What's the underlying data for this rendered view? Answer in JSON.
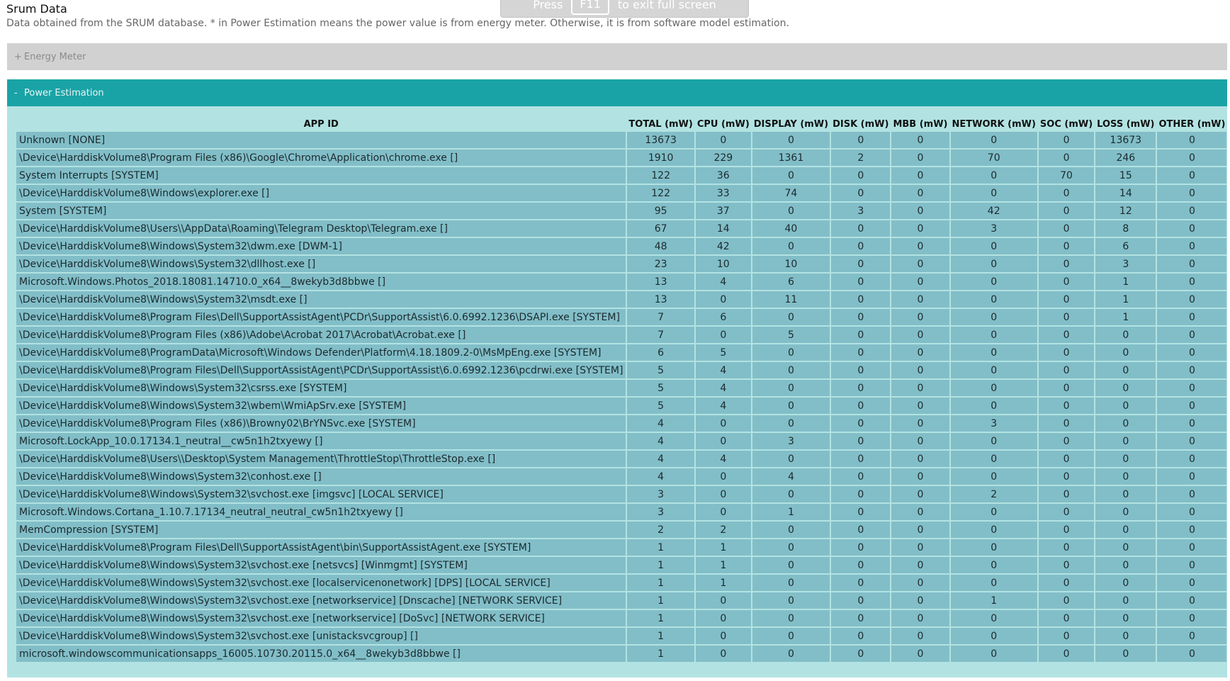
{
  "fullscreen_banner": {
    "press_label": "Press",
    "key_label": "F11",
    "suffix_label": "to exit full screen"
  },
  "page": {
    "title": "Srum Data",
    "subtitle": "Data obtained from the SRUM database. * in Power Estimation means the power value is from energy meter. Otherwise, it is from software model estimation."
  },
  "sections": {
    "energy_meter": {
      "toggle": "+",
      "label": "Energy Meter"
    },
    "power_estimation": {
      "toggle": "-",
      "label": "Power Estimation"
    }
  },
  "colors": {
    "collapsed_header": "#d1d1d1",
    "expanded_header": "#1aa3a6",
    "section_body": "#b2e3e2",
    "cell": "#82bec8"
  },
  "table": {
    "columns": [
      "APP ID",
      "TOTAL (mW)",
      "CPU (mW)",
      "DISPLAY (mW)",
      "DISK (mW)",
      "MBB (mW)",
      "NETWORK (mW)",
      "SOC (mW)",
      "LOSS (mW)",
      "OTHER (mW)"
    ],
    "rows": [
      [
        "Unknown [NONE]",
        "13673",
        "0",
        "0",
        "0",
        "0",
        "0",
        "0",
        "13673",
        "0"
      ],
      [
        "\\Device\\HarddiskVolume8\\Program Files (x86)\\Google\\Chrome\\Application\\chrome.exe []",
        "1910",
        "229",
        "1361",
        "2",
        "0",
        "70",
        "0",
        "246",
        "0"
      ],
      [
        "System Interrupts [SYSTEM]",
        "122",
        "36",
        "0",
        "0",
        "0",
        "0",
        "70",
        "15",
        "0"
      ],
      [
        "\\Device\\HarddiskVolume8\\Windows\\explorer.exe []",
        "122",
        "33",
        "74",
        "0",
        "0",
        "0",
        "0",
        "14",
        "0"
      ],
      [
        "System [SYSTEM]",
        "95",
        "37",
        "0",
        "3",
        "0",
        "42",
        "0",
        "12",
        "0"
      ],
      [
        "\\Device\\HarddiskVolume8\\Users\\\\AppData\\Roaming\\Telegram Desktop\\Telegram.exe []",
        "67",
        "14",
        "40",
        "0",
        "0",
        "3",
        "0",
        "8",
        "0"
      ],
      [
        "\\Device\\HarddiskVolume8\\Windows\\System32\\dwm.exe [DWM-1]",
        "48",
        "42",
        "0",
        "0",
        "0",
        "0",
        "0",
        "6",
        "0"
      ],
      [
        "\\Device\\HarddiskVolume8\\Windows\\System32\\dllhost.exe []",
        "23",
        "10",
        "10",
        "0",
        "0",
        "0",
        "0",
        "3",
        "0"
      ],
      [
        "Microsoft.Windows.Photos_2018.18081.14710.0_x64__8wekyb3d8bbwe []",
        "13",
        "4",
        "6",
        "0",
        "0",
        "0",
        "0",
        "1",
        "0"
      ],
      [
        "\\Device\\HarddiskVolume8\\Windows\\System32\\msdt.exe []",
        "13",
        "0",
        "11",
        "0",
        "0",
        "0",
        "0",
        "1",
        "0"
      ],
      [
        "\\Device\\HarddiskVolume8\\Program Files\\Dell\\SupportAssistAgent\\PCDr\\SupportAssist\\6.0.6992.1236\\DSAPI.exe [SYSTEM]",
        "7",
        "6",
        "0",
        "0",
        "0",
        "0",
        "0",
        "1",
        "0"
      ],
      [
        "\\Device\\HarddiskVolume8\\Program Files (x86)\\Adobe\\Acrobat 2017\\Acrobat\\Acrobat.exe []",
        "7",
        "0",
        "5",
        "0",
        "0",
        "0",
        "0",
        "0",
        "0"
      ],
      [
        "\\Device\\HarddiskVolume8\\ProgramData\\Microsoft\\Windows Defender\\Platform\\4.18.1809.2-0\\MsMpEng.exe [SYSTEM]",
        "6",
        "5",
        "0",
        "0",
        "0",
        "0",
        "0",
        "0",
        "0"
      ],
      [
        "\\Device\\HarddiskVolume8\\Program Files\\Dell\\SupportAssistAgent\\PCDr\\SupportAssist\\6.0.6992.1236\\pcdrwi.exe [SYSTEM]",
        "5",
        "4",
        "0",
        "0",
        "0",
        "0",
        "0",
        "0",
        "0"
      ],
      [
        "\\Device\\HarddiskVolume8\\Windows\\System32\\csrss.exe [SYSTEM]",
        "5",
        "4",
        "0",
        "0",
        "0",
        "0",
        "0",
        "0",
        "0"
      ],
      [
        "\\Device\\HarddiskVolume8\\Windows\\System32\\wbem\\WmiApSrv.exe [SYSTEM]",
        "5",
        "4",
        "0",
        "0",
        "0",
        "0",
        "0",
        "0",
        "0"
      ],
      [
        "\\Device\\HarddiskVolume8\\Program Files (x86)\\Browny02\\BrYNSvc.exe [SYSTEM]",
        "4",
        "0",
        "0",
        "0",
        "0",
        "3",
        "0",
        "0",
        "0"
      ],
      [
        "Microsoft.LockApp_10.0.17134.1_neutral__cw5n1h2txyewy []",
        "4",
        "0",
        "3",
        "0",
        "0",
        "0",
        "0",
        "0",
        "0"
      ],
      [
        "\\Device\\HarddiskVolume8\\Users\\\\Desktop\\System Management\\ThrottleStop\\ThrottleStop.exe []",
        "4",
        "4",
        "0",
        "0",
        "0",
        "0",
        "0",
        "0",
        "0"
      ],
      [
        "\\Device\\HarddiskVolume8\\Windows\\System32\\conhost.exe []",
        "4",
        "0",
        "4",
        "0",
        "0",
        "0",
        "0",
        "0",
        "0"
      ],
      [
        "\\Device\\HarddiskVolume8\\Windows\\System32\\svchost.exe [imgsvc] [LOCAL SERVICE]",
        "3",
        "0",
        "0",
        "0",
        "0",
        "2",
        "0",
        "0",
        "0"
      ],
      [
        "Microsoft.Windows.Cortana_1.10.7.17134_neutral_neutral_cw5n1h2txyewy []",
        "3",
        "0",
        "1",
        "0",
        "0",
        "0",
        "0",
        "0",
        "0"
      ],
      [
        "MemCompression [SYSTEM]",
        "2",
        "2",
        "0",
        "0",
        "0",
        "0",
        "0",
        "0",
        "0"
      ],
      [
        "\\Device\\HarddiskVolume8\\Program Files\\Dell\\SupportAssistAgent\\bin\\SupportAssistAgent.exe [SYSTEM]",
        "1",
        "1",
        "0",
        "0",
        "0",
        "0",
        "0",
        "0",
        "0"
      ],
      [
        "\\Device\\HarddiskVolume8\\Windows\\System32\\svchost.exe [netsvcs] [Winmgmt] [SYSTEM]",
        "1",
        "1",
        "0",
        "0",
        "0",
        "0",
        "0",
        "0",
        "0"
      ],
      [
        "\\Device\\HarddiskVolume8\\Windows\\System32\\svchost.exe [localservicenonetwork] [DPS] [LOCAL SERVICE]",
        "1",
        "1",
        "0",
        "0",
        "0",
        "0",
        "0",
        "0",
        "0"
      ],
      [
        "\\Device\\HarddiskVolume8\\Windows\\System32\\svchost.exe [networkservice] [Dnscache] [NETWORK SERVICE]",
        "1",
        "0",
        "0",
        "0",
        "0",
        "1",
        "0",
        "0",
        "0"
      ],
      [
        "\\Device\\HarddiskVolume8\\Windows\\System32\\svchost.exe [networkservice] [DoSvc] [NETWORK SERVICE]",
        "1",
        "0",
        "0",
        "0",
        "0",
        "0",
        "0",
        "0",
        "0"
      ],
      [
        "\\Device\\HarddiskVolume8\\Windows\\System32\\svchost.exe [unistacksvcgroup] []",
        "1",
        "0",
        "0",
        "0",
        "0",
        "0",
        "0",
        "0",
        "0"
      ],
      [
        "microsoft.windowscommunicationsapps_16005.10730.20115.0_x64__8wekyb3d8bbwe []",
        "1",
        "0",
        "0",
        "0",
        "0",
        "0",
        "0",
        "0",
        "0"
      ]
    ]
  }
}
